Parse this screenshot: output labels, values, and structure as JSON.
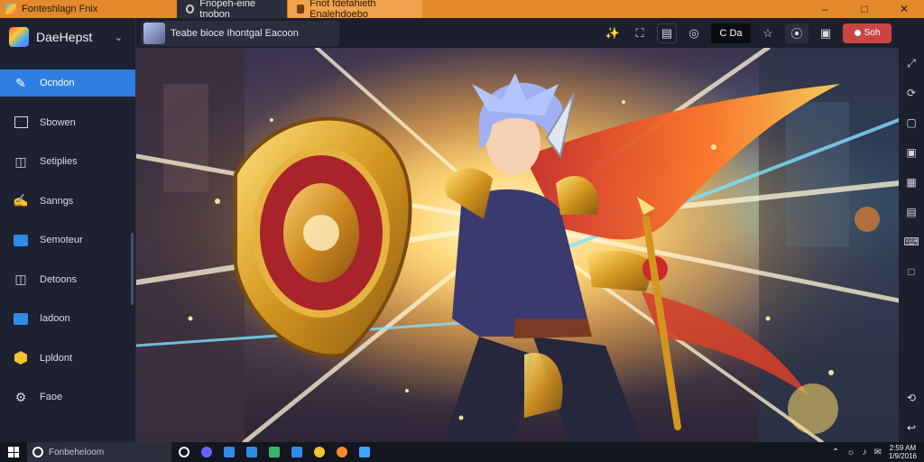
{
  "titlebar": {
    "app_name": "Fonteshlagn Fnix",
    "tabs": [
      {
        "label": "Fnopeh-eine tnobon"
      },
      {
        "label": "Fnot fdefahieth Enalehdoebo"
      }
    ],
    "controls": {
      "minimize": "–",
      "maximize": "□",
      "close": "✕"
    }
  },
  "sidebar": {
    "brand": "DaeHepst",
    "items": [
      {
        "label": "Ocndon",
        "icon": "edit-icon",
        "active": true
      },
      {
        "label": "Sbowen",
        "icon": "square-icon",
        "active": false
      },
      {
        "label": "Setiplies",
        "icon": "screen-icon",
        "active": false
      },
      {
        "label": "Sanngs",
        "icon": "pen-icon",
        "active": false
      },
      {
        "label": "Semoteur",
        "icon": "window-blue-icon",
        "active": false
      },
      {
        "label": "Detoons",
        "icon": "panel-icon",
        "active": false
      },
      {
        "label": "Iadoon",
        "icon": "blue-app-icon",
        "active": false
      },
      {
        "label": "Lpldont",
        "icon": "gold-hex-icon",
        "active": false
      },
      {
        "label": "Faoe",
        "icon": "gear-icon",
        "active": false
      }
    ]
  },
  "toolbar": {
    "game_title": "Teabe bioce Ihontgal Eacoon",
    "fps_label": "C Da",
    "record_label": "Soh",
    "tools": [
      "pointer-icon",
      "fullscreen-icon",
      "document-icon",
      "target-icon",
      "fps-display",
      "star-icon",
      "shield-icon",
      "android-icon",
      "record-button"
    ]
  },
  "rightrail": {
    "icons": [
      "expand-icon",
      "rotate-icon",
      "screenshot-icon",
      "capture-icon",
      "camera-icon",
      "layers-icon",
      "keyboard-icon",
      "aspect-icon",
      "back-icon",
      "return-icon"
    ]
  },
  "taskbar": {
    "search_placeholder": "Fonbeheloom",
    "apps": [
      {
        "name": "cortana-icon",
        "color": "#ffffff"
      },
      {
        "name": "edge-icon",
        "color": "#6a63ff"
      },
      {
        "name": "store-icon",
        "color": "#2f8ae8"
      },
      {
        "name": "explorer-icon",
        "color": "#2f8ae8"
      },
      {
        "name": "xbox-icon",
        "color": "#35b56a"
      },
      {
        "name": "photos-icon",
        "color": "#2f8ae8"
      },
      {
        "name": "chrome-icon",
        "color": "#f2c230"
      },
      {
        "name": "firefox-icon",
        "color": "#ff8a2a"
      },
      {
        "name": "emulator-icon",
        "color": "#3fa7ff"
      }
    ],
    "clock_time": "2:59 AM",
    "clock_date": "1/9/2016"
  },
  "colors": {
    "accent": "#2f7fe0",
    "titlebar": "#e28a2c",
    "record": "#c94545"
  }
}
